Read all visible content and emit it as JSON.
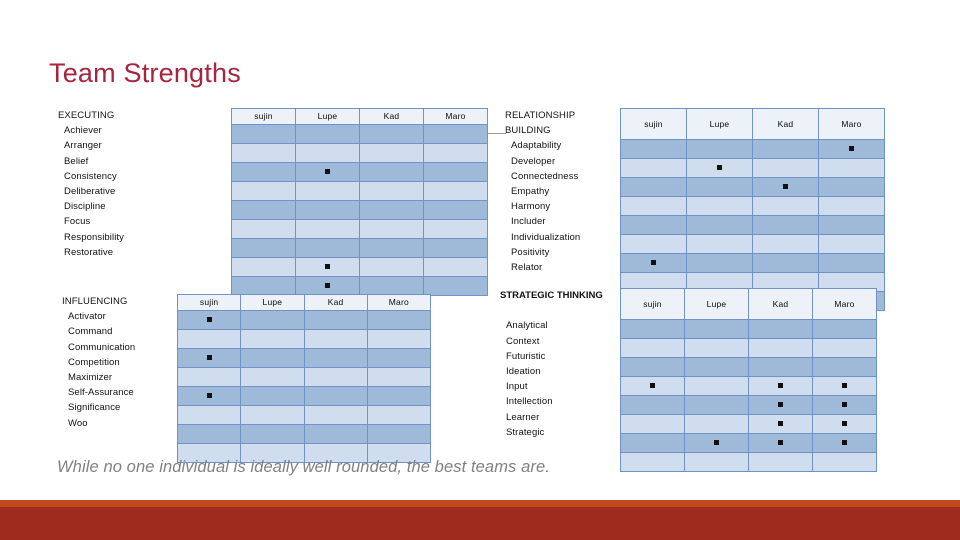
{
  "title": "Team Strengths",
  "caption": "While no one individual is ideally well rounded, the best teams are.",
  "colors": {
    "title": "#A8243F",
    "grid_border": "#6E93C4",
    "row_dark": "#9FBAD9",
    "row_light": "#CFDDEF",
    "header_fill": "#EDF2F8",
    "bar_orange": "#C1471C",
    "bar_red": "#9E2B1E",
    "caption_text": "#808184"
  },
  "members": [
    "sujin",
    "Lupe",
    "Kad",
    "Maro"
  ],
  "quadrants": [
    {
      "id": "executing",
      "category": "EXECUTING",
      "category_lines": [
        "EXECUTING"
      ],
      "strengths": [
        "Achiever",
        "Arranger",
        "Belief",
        "Consistency",
        "Deliberative",
        "Discipline",
        "Focus",
        "Responsibility",
        "Restorative"
      ],
      "marks": [
        [
          false,
          false,
          false,
          false
        ],
        [
          false,
          false,
          false,
          false
        ],
        [
          false,
          true,
          false,
          false
        ],
        [
          false,
          false,
          false,
          false
        ],
        [
          false,
          false,
          false,
          false
        ],
        [
          false,
          false,
          false,
          false
        ],
        [
          false,
          false,
          false,
          false
        ],
        [
          false,
          true,
          false,
          false
        ],
        [
          false,
          true,
          false,
          false
        ]
      ]
    },
    {
      "id": "relationship-building",
      "category": "RELATIONSHIP BUILDING",
      "category_lines": [
        "RELATIONSHIP",
        "BUILDING"
      ],
      "strengths": [
        "Adaptability",
        "Developer",
        "Connectedness",
        "Empathy",
        "Harmony",
        "Includer",
        "Individualization",
        "Positivity",
        "Relator"
      ],
      "marks": [
        [
          false,
          false,
          false,
          true
        ],
        [
          false,
          true,
          false,
          false
        ],
        [
          false,
          false,
          true,
          false
        ],
        [
          false,
          false,
          false,
          false
        ],
        [
          false,
          false,
          false,
          false
        ],
        [
          false,
          false,
          false,
          false
        ],
        [
          true,
          false,
          false,
          false
        ],
        [
          false,
          false,
          false,
          false
        ],
        [
          false,
          false,
          false,
          false
        ]
      ]
    },
    {
      "id": "influencing",
      "category": "INFLUENCING",
      "category_lines": [
        "INFLUENCING"
      ],
      "strengths": [
        "Activator",
        "Command",
        "Communication",
        "Competition",
        "Maximizer",
        "Self-Assurance",
        "Significance",
        "Woo"
      ],
      "marks": [
        [
          true,
          false,
          false,
          false
        ],
        [
          false,
          false,
          false,
          false
        ],
        [
          true,
          false,
          false,
          false
        ],
        [
          false,
          false,
          false,
          false
        ],
        [
          true,
          false,
          false,
          false
        ],
        [
          false,
          false,
          false,
          false
        ],
        [
          false,
          false,
          false,
          false
        ],
        [
          false,
          false,
          false,
          false
        ]
      ]
    },
    {
      "id": "strategic-thinking",
      "category": "STRATEGIC THINKING",
      "category_lines": [
        "STRATEGIC THINKING",
        ""
      ],
      "strengths": [
        "Analytical",
        "Context",
        "Futuristic",
        "Ideation",
        "Input",
        "Intellection",
        "Learner",
        "Strategic"
      ],
      "marks": [
        [
          false,
          false,
          false,
          false
        ],
        [
          false,
          false,
          false,
          false
        ],
        [
          false,
          false,
          false,
          false
        ],
        [
          true,
          false,
          true,
          true
        ],
        [
          false,
          false,
          true,
          true
        ],
        [
          false,
          false,
          true,
          true
        ],
        [
          false,
          true,
          true,
          true
        ],
        [
          false,
          false,
          false,
          false
        ]
      ]
    }
  ]
}
